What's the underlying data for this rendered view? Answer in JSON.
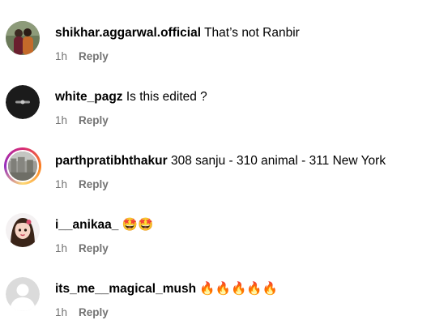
{
  "comments": [
    {
      "avatar": "couple-photo",
      "username": "shikhar.aggarwal.official",
      "text": "That’s not Ranbir",
      "time": "1h",
      "reply_label": "Reply"
    },
    {
      "avatar": "dark-logo",
      "username": "white_pagz",
      "text": "Is this edited ?",
      "time": "1h",
      "reply_label": "Reply"
    },
    {
      "avatar": "photo-with-story-ring",
      "username": "parthpratibhthakur",
      "text": "308 sanju - 310 animal - 311 New York",
      "time": "1h",
      "reply_label": "Reply"
    },
    {
      "avatar": "cartoon-girl",
      "username": "i__anikaa_",
      "text": "🤩🤩",
      "time": "1h",
      "reply_label": "Reply"
    },
    {
      "avatar": "default-user",
      "username": "its_me__magical_mush",
      "text": "🔥🔥🔥🔥🔥",
      "time": "1h",
      "reply_label": "Reply"
    }
  ],
  "colors": {
    "username": "#000000",
    "meta": "#737373",
    "background": "#ffffff"
  }
}
